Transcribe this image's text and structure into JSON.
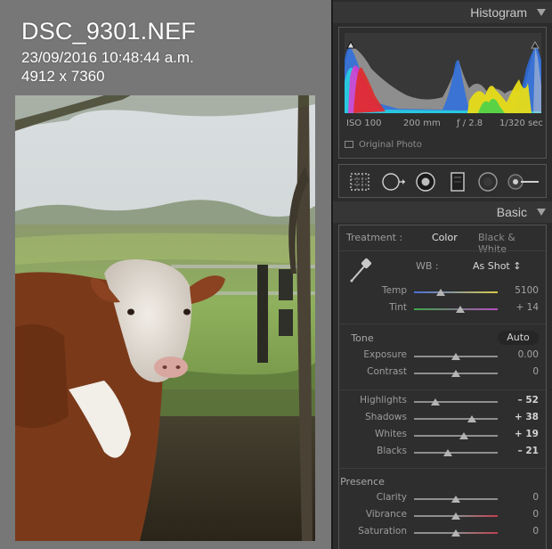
{
  "overlay": {
    "filename": "DSC_9301.NEF",
    "datetime": "23/09/2016 10:48:44 a.m.",
    "dimensions": "4912 x 7360"
  },
  "histogram": {
    "title": "Histogram",
    "iso": "ISO 100",
    "focal": "200 mm",
    "aperture": "ƒ / 2.8",
    "shutter": "1/320 sec",
    "original_photo_label": "Original Photo",
    "original_photo_checked": false
  },
  "tools": [
    "crop-overlay-icon",
    "spot-removal-icon",
    "red-eye-icon",
    "graduated-filter-icon",
    "radial-filter-icon",
    "adjustment-brush-icon"
  ],
  "basic": {
    "title": "Basic",
    "treatment_label": "Treatment :",
    "treatment_color": "Color",
    "treatment_bw": "Black & White",
    "wb_label": "WB :",
    "wb_value": "As Shot ↕",
    "tone_label": "Tone",
    "auto_label": "Auto",
    "presence_label": "Presence",
    "sliders": [
      {
        "id": "temp",
        "label": "Temp",
        "value": "5100",
        "pos": 0.32,
        "bold": false
      },
      {
        "id": "tint",
        "label": "Tint",
        "value": "+ 14",
        "pos": 0.55,
        "bold": false
      },
      {
        "id": "exposure",
        "label": "Exposure",
        "value": "0.00",
        "pos": 0.5,
        "bold": false
      },
      {
        "id": "contrast",
        "label": "Contrast",
        "value": "0",
        "pos": 0.5,
        "bold": false
      },
      {
        "id": "highlights",
        "label": "Highlights",
        "value": "– 52",
        "pos": 0.26,
        "bold": true
      },
      {
        "id": "shadows",
        "label": "Shadows",
        "value": "+ 38",
        "pos": 0.69,
        "bold": true
      },
      {
        "id": "whites",
        "label": "Whites",
        "value": "+ 19",
        "pos": 0.6,
        "bold": true
      },
      {
        "id": "blacks",
        "label": "Blacks",
        "value": "– 21",
        "pos": 0.4,
        "bold": true
      },
      {
        "id": "clarity",
        "label": "Clarity",
        "value": "0",
        "pos": 0.5,
        "bold": false
      },
      {
        "id": "vibrance",
        "label": "Vibrance",
        "value": "0",
        "pos": 0.5,
        "bold": false
      },
      {
        "id": "saturation",
        "label": "Saturation",
        "value": "0",
        "pos": 0.5,
        "bold": false
      }
    ]
  },
  "colors": {
    "panel_bg": "#2c2c2c",
    "header_bg": "#363636",
    "canvas_bg": "#777777",
    "temp_start": "#4a6fd8",
    "temp_end": "#d8c84a",
    "tint_start": "#3fa64a",
    "tint_end": "#b54fc0",
    "vibrance_end": "#c0404e",
    "saturation_end": "#c0404e"
  }
}
